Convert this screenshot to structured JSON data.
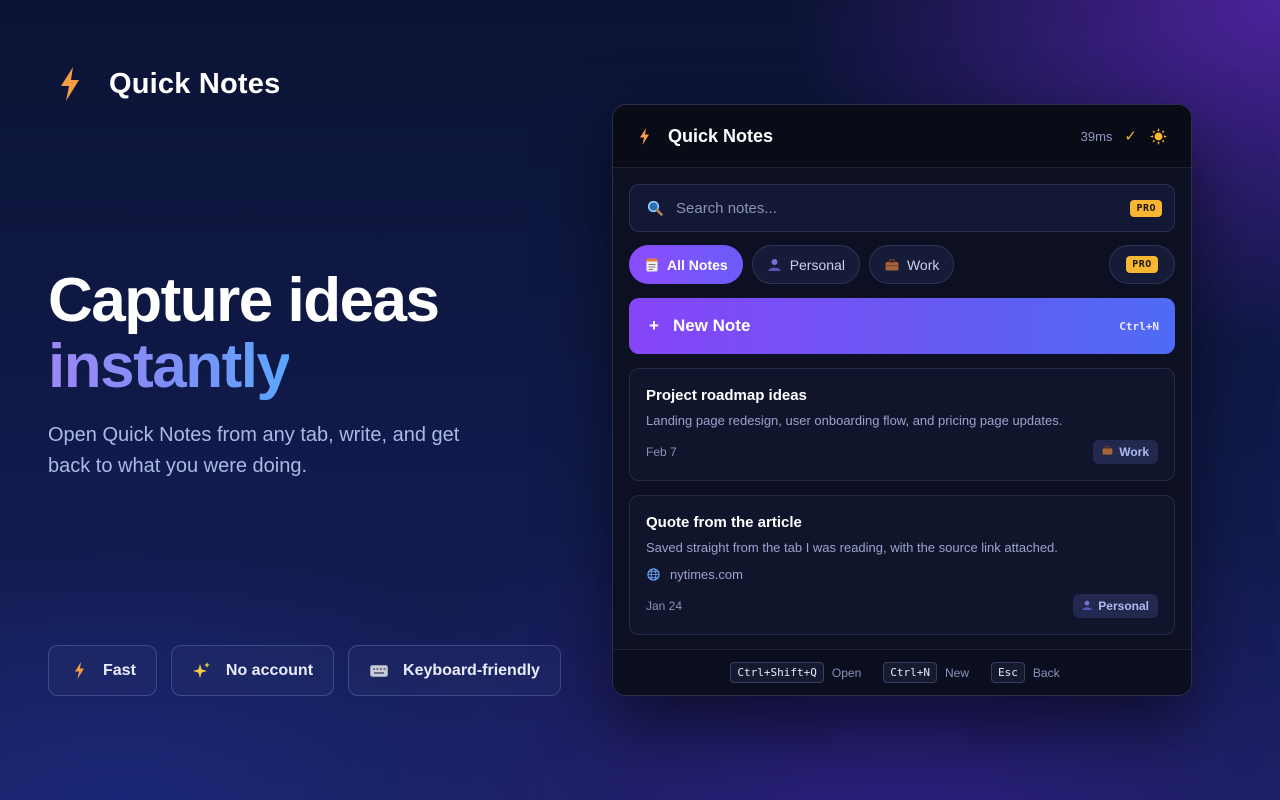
{
  "brand": {
    "name": "Quick Notes",
    "icon": "lightning-bolt-icon",
    "accent": "#f59b42"
  },
  "hero": {
    "line1": "Capture ideas",
    "line2": "instantly",
    "subtitle": "Open Quick Notes from any tab, write, and get back to what you were doing."
  },
  "features": [
    {
      "icon": "lightning-bolt-icon",
      "label": "Fast"
    },
    {
      "icon": "sparkles-icon",
      "label": "No account"
    },
    {
      "icon": "keyboard-icon",
      "label": "Keyboard-friendly"
    }
  ],
  "popup": {
    "title": "Quick Notes",
    "latency": "39ms",
    "status_icon": "checkmark-icon",
    "theme_icon": "sun-icon",
    "search": {
      "placeholder": "Search notes...",
      "badge": "PRO"
    },
    "tabs": [
      {
        "icon": "notepad-icon",
        "label": "All Notes",
        "active": true
      },
      {
        "icon": "person-icon",
        "label": "Personal",
        "active": false
      },
      {
        "icon": "briefcase-icon",
        "label": "Work",
        "active": false
      }
    ],
    "tabs_pro_badge": "PRO",
    "new_note": {
      "label": "New Note",
      "shortcut": "Ctrl+N"
    },
    "notes": [
      {
        "title": "Project roadmap ideas",
        "body": "Landing page redesign, user onboarding flow, and pricing page updates.",
        "date": "Feb 7",
        "tag": "Work",
        "tag_icon": "briefcase-icon"
      },
      {
        "title": "Quote from the article",
        "body": "Saved straight from the tab I was reading, with the source link attached.",
        "source": "nytimes.com",
        "date": "Jan 24",
        "tag": "Personal",
        "tag_icon": "person-icon"
      }
    ],
    "shortcuts": [
      {
        "key": "Ctrl+Shift+Q",
        "label": "Open"
      },
      {
        "key": "Ctrl+N",
        "label": "New"
      },
      {
        "key": "Esc",
        "label": "Back"
      }
    ]
  },
  "colors": {
    "accent_purple": "#8b4dff",
    "accent_blue": "#4f6bf4",
    "pro_badge": "#f7b733",
    "background": "#0b1333"
  }
}
